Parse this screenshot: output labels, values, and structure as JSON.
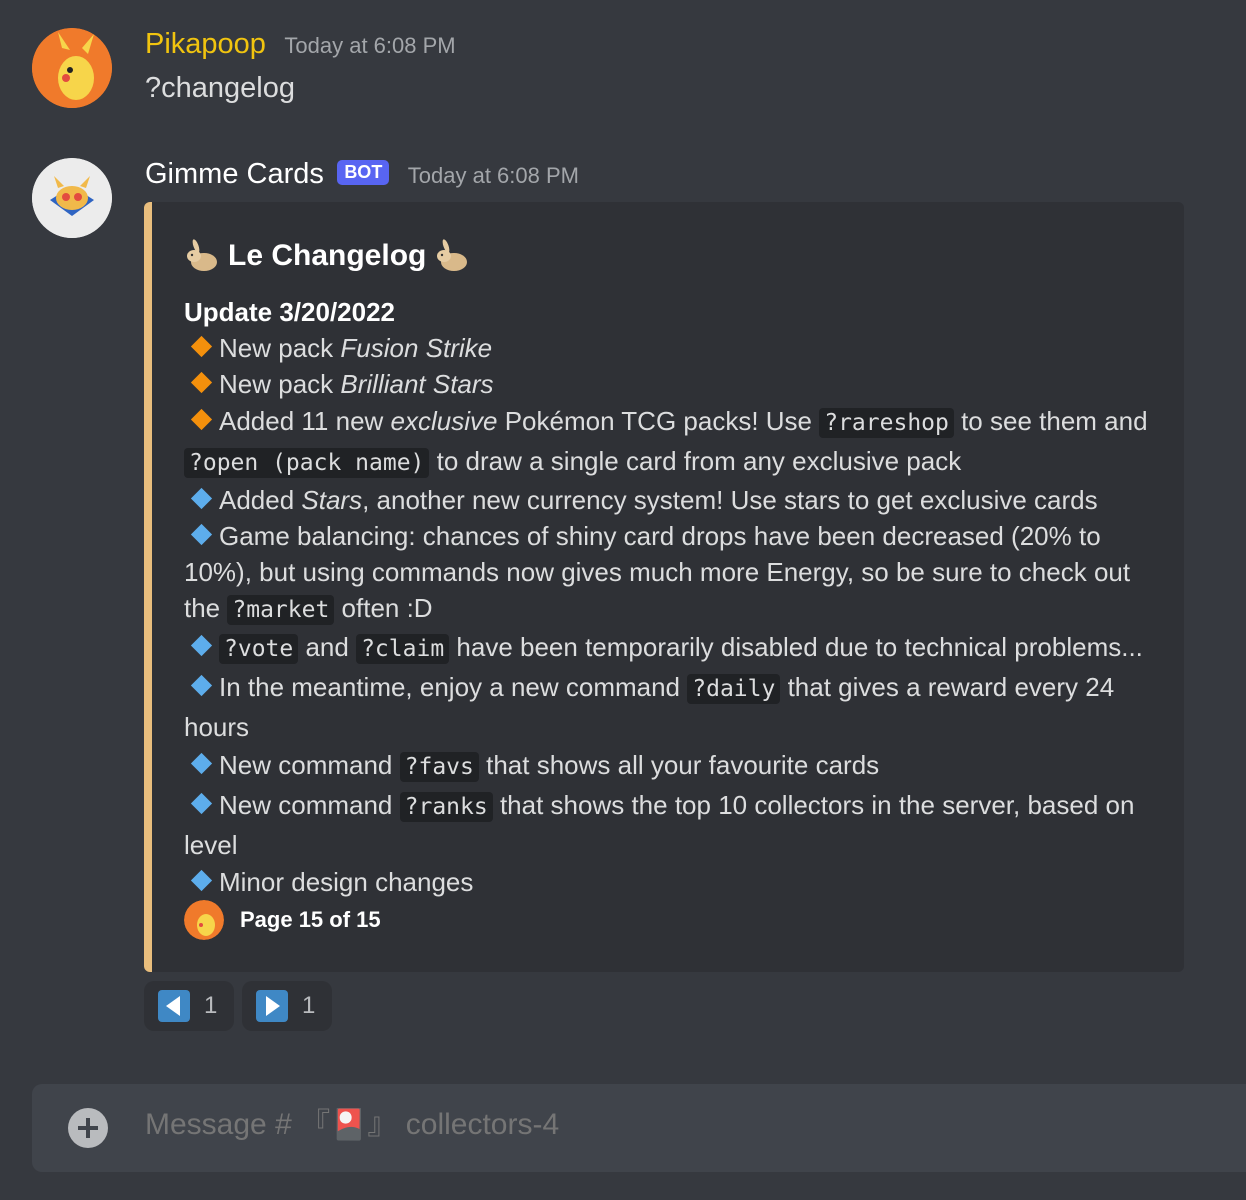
{
  "messages": [
    {
      "author": "Pikapoop",
      "author_color": "#f1c40f",
      "timestamp": "Today at 6:08 PM",
      "text": "?changelog"
    },
    {
      "author": "Gimme Cards",
      "author_color": "#ffffff",
      "bot_tag": "BOT",
      "timestamp": "Today at 6:08 PM"
    }
  ],
  "embed": {
    "border_color": "#e9be7d",
    "title": "Le Changelog",
    "title_icon": "rabbit-icon",
    "update_heading": "Update 3/20/2022",
    "lines": {
      "l1_a": "New pack ",
      "l1_b": "Fusion Strike",
      "l2_a": "New pack ",
      "l2_b": "Brilliant Stars",
      "l3_a": "Added 11 new ",
      "l3_b": "exclusive",
      "l3_c": " Pokémon TCG packs! Use ",
      "l3_code1": "?rareshop",
      "l3_d": " to see them and ",
      "l3_code2": "?open (pack name)",
      "l3_e": " to draw a single card from any exclusive pack",
      "l4_a": "Added ",
      "l4_b": "Stars",
      "l4_c": ", another new currency system! Use stars to get exclusive cards",
      "l5_a": "Game balancing: chances of shiny card drops have been decreased (20% to 10%), but using commands now gives much more Energy, so be sure to check out the ",
      "l5_code": "?market",
      "l5_b": " often :D",
      "l6_code1": "?vote",
      "l6_a": " and ",
      "l6_code2": "?claim",
      "l6_b": " have been temporarily disabled due to technical problems...",
      "l7_a": "In the meantime, enjoy a new command ",
      "l7_code": "?daily",
      "l7_b": " that gives a reward every 24 hours",
      "l8_a": "New command ",
      "l8_code": "?favs",
      "l8_b": " that shows all your favourite cards",
      "l9_a": "New command ",
      "l9_code": "?ranks",
      "l9_b": " that shows the top 10 collectors in the server, based on level",
      "l10_a": "Minor design changes"
    },
    "footer": "Page 15 of 15"
  },
  "reactions": [
    {
      "emoji": "arrow-backward-icon",
      "count": "1"
    },
    {
      "emoji": "arrow-forward-icon",
      "count": "1"
    }
  ],
  "composer": {
    "placeholder": "Message # 『🎴』 collectors-4"
  }
}
